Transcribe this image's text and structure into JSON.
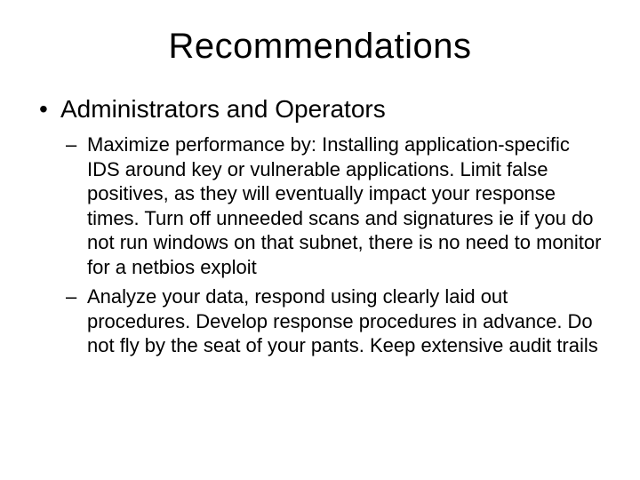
{
  "title": "Recommendations",
  "bullets": {
    "level1": [
      {
        "text": "Administrators and Operators",
        "children": [
          "Maximize performance by: Installing application-specific IDS around key or vulnerable applications.  Limit false positives, as they will eventually impact your response times.  Turn off unneeded scans and signatures ie if you do not run windows on that subnet, there is no need to monitor for a netbios exploit",
          "Analyze your data, respond using clearly laid out procedures.  Develop response procedures in advance.  Do not fly by the seat of your pants.  Keep extensive audit trails"
        ]
      }
    ]
  }
}
